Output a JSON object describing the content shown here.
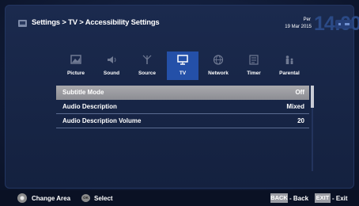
{
  "header": {
    "breadcrumb": "Settings > TV > Accessibility Settings",
    "day": "Per",
    "date": "19 Mar 2015",
    "time": "14:00"
  },
  "tabs": [
    {
      "label": "Picture",
      "icon": "picture-icon",
      "active": false
    },
    {
      "label": "Sound",
      "icon": "speaker-icon",
      "active": false
    },
    {
      "label": "Source",
      "icon": "antenna-icon",
      "active": false
    },
    {
      "label": "TV",
      "icon": "tv-icon",
      "active": true
    },
    {
      "label": "Network",
      "icon": "globe-icon",
      "active": false
    },
    {
      "label": "Timer",
      "icon": "timer-icon",
      "active": false
    },
    {
      "label": "Parental",
      "icon": "parental-icon",
      "active": false
    }
  ],
  "settings": [
    {
      "label": "Subtitle Mode",
      "value": "Off",
      "selected": true
    },
    {
      "label": "Audio Description",
      "value": "Mixed",
      "selected": false
    },
    {
      "label": "Audio Description Volume",
      "value": "20",
      "selected": false
    }
  ],
  "footer": {
    "change_area": "Change Area",
    "ok_key": "OK",
    "select": "Select",
    "back_key": "BACK",
    "back": "Back",
    "exit_key": "EXIT",
    "exit": "Exit"
  },
  "colors": {
    "accent": "#2450a8",
    "selected_row": "#9d9ea3",
    "background": "#14213f"
  }
}
